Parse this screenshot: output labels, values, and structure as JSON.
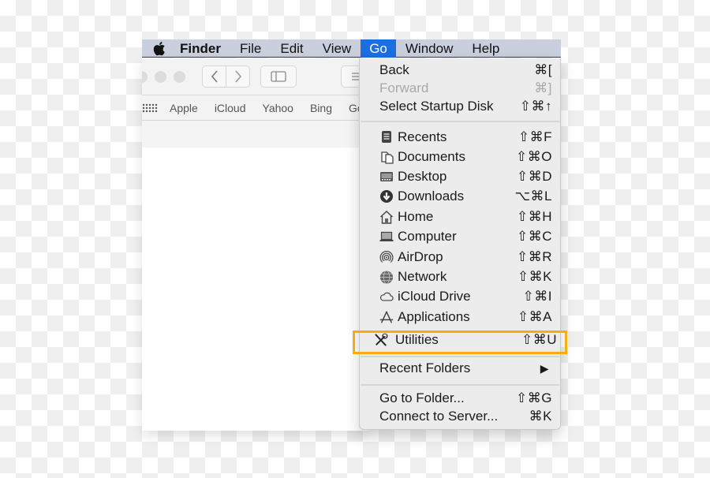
{
  "menubar": {
    "apple_icon": "apple-logo-icon",
    "items": [
      {
        "label": "Finder",
        "bold": true
      },
      {
        "label": "File"
      },
      {
        "label": "Edit"
      },
      {
        "label": "View"
      },
      {
        "label": "Go",
        "active": true
      },
      {
        "label": "Window"
      },
      {
        "label": "Help"
      }
    ]
  },
  "window": {
    "toolbar": {
      "back_icon": "chevron-left-icon",
      "forward_icon": "chevron-right-icon",
      "sidebar_icon": "sidebar-icon",
      "list_icon": "list-icon"
    },
    "favorites": [
      "Apple",
      "iCloud",
      "Yahoo",
      "Bing",
      "Go"
    ]
  },
  "go_menu": {
    "items": [
      {
        "label": "Back",
        "shortcut": "⌘[",
        "disabled": false
      },
      {
        "label": "Forward",
        "shortcut": "⌘]",
        "disabled": true
      },
      {
        "label": "Select Startup Disk",
        "shortcut": "⇧⌘↑",
        "disabled": false
      },
      {
        "label": "Recents",
        "shortcut": "⇧⌘F",
        "icon": "recents-icon"
      },
      {
        "label": "Documents",
        "shortcut": "⇧⌘O",
        "icon": "documents-icon"
      },
      {
        "label": "Desktop",
        "shortcut": "⇧⌘D",
        "icon": "desktop-icon"
      },
      {
        "label": "Downloads",
        "shortcut": "⌥⌘L",
        "icon": "downloads-icon"
      },
      {
        "label": "Home",
        "shortcut": "⇧⌘H",
        "icon": "home-icon"
      },
      {
        "label": "Computer",
        "shortcut": "⇧⌘C",
        "icon": "computer-icon"
      },
      {
        "label": "AirDrop",
        "shortcut": "⇧⌘R",
        "icon": "airdrop-icon"
      },
      {
        "label": "Network",
        "shortcut": "⇧⌘K",
        "icon": "network-icon"
      },
      {
        "label": "iCloud Drive",
        "shortcut": "⇧⌘I",
        "icon": "icloud-icon"
      },
      {
        "label": "Applications",
        "shortcut": "⇧⌘A",
        "icon": "applications-icon"
      },
      {
        "label": "Utilities",
        "shortcut": "⇧⌘U",
        "icon": "utilities-icon",
        "highlighted": true
      },
      {
        "label": "Recent Folders",
        "shortcut": "▶",
        "submenu": true
      },
      {
        "label": "Go to Folder...",
        "shortcut": "⇧⌘G"
      },
      {
        "label": "Connect to Server...",
        "shortcut": "⌘K"
      }
    ]
  },
  "colors": {
    "menubar_bg": "#c9cfdc",
    "active_menu": "#1c6fe0",
    "highlight_border": "#f6ad13",
    "menu_bg": "#ececec"
  }
}
